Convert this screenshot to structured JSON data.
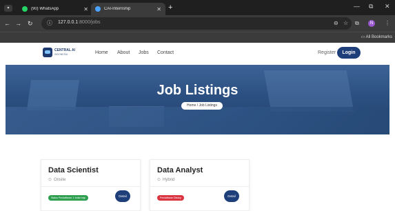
{
  "browser": {
    "tabs": [
      {
        "title": "(90) WhatsApp",
        "icon": "whatsapp-icon",
        "icon_color": "#25d366",
        "active": false
      },
      {
        "title": "CAI-Internship",
        "icon": "site-icon",
        "icon_color": "#4aa3ff",
        "active": true
      }
    ],
    "new_tab_label": "+",
    "url_host": "127.0.0.1",
    "url_path": ":8000/jobs",
    "bookmarks_label": "All Bookmarks",
    "profile_initial": "N"
  },
  "site": {
    "logo_text": "CENTRAL AI",
    "logo_subtext": "INDONESIA",
    "nav": [
      "Home",
      "About",
      "Jobs",
      "Contact"
    ],
    "register_label": "Register",
    "login_label": "Login",
    "hero_title": "Job Listings",
    "breadcrumb": "Home / Job Listings",
    "jobs": [
      {
        "title": "Data Scientist",
        "location": "Onsite",
        "status": "Status Pendaftaran: 1 bulan lagi",
        "status_color": "#2e9e4f",
        "detail_label": "Detail"
      },
      {
        "title": "Data Analyst",
        "location": "Hybrid",
        "status": "Pendaftaran Ditutup",
        "status_color": "#d9343f",
        "detail_label": "Detail"
      }
    ]
  },
  "colors": {
    "primary": "#1f3f7a",
    "hero": "#2b4f80"
  }
}
